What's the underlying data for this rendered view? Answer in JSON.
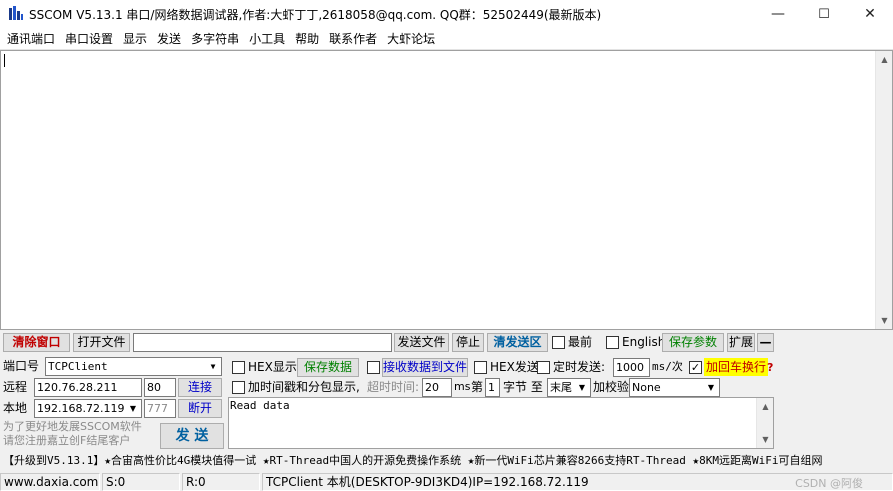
{
  "window": {
    "title": "SSCOM V5.13.1 串口/网络数据调试器,作者:大虾丁丁,2618058@qq.com. QQ群：52502449(最新版本)",
    "minimize": "—",
    "maximize": "☐",
    "close": "✕"
  },
  "menu": [
    "通讯端口",
    "串口设置",
    "显示",
    "发送",
    "多字符串",
    "小工具",
    "帮助",
    "联系作者",
    "大虾论坛"
  ],
  "toolbar": {
    "clear_window": "清除窗口",
    "open_file": "打开文件",
    "send_file": "发送文件",
    "stop": "停止",
    "clear_send": "清发送区",
    "topmost": "最前",
    "english": "English",
    "save_params": "保存参数",
    "expand": "扩展",
    "collapse": "—"
  },
  "connection": {
    "port_label": "端口号",
    "port_value": "TCPClient",
    "remote_label": "远程",
    "remote_ip": "120.76.28.211",
    "remote_port": "80",
    "connect": "连接",
    "local_label": "本地",
    "local_ip": "192.168.72.119",
    "local_port": "777",
    "disconnect": "断开",
    "promo_line1": "为了更好地发展SSCOM软件",
    "promo_line2": "请您注册嘉立创F结尾客户",
    "send": "发 送"
  },
  "options": {
    "hex_display": "HEX显示",
    "save_data": "保存数据",
    "recv_to_file": "接收数据到文件",
    "hex_send": "HEX发送",
    "timed_send": "定时发送:",
    "interval": "1000",
    "interval_unit": "ms/次",
    "add_crlf": "加回车换行",
    "add_crlf_checked": "✓",
    "timestamp": "加时间戳和分包显示,",
    "timeout_label": "超时时间:",
    "timeout_value": "20",
    "timeout_unit": "ms",
    "byte_prefix": "第",
    "byte_index": "1",
    "byte_label": "字节 至",
    "byte_end": "末尾",
    "checksum_label": "加校验",
    "checksum_value": "None",
    "help_mark": "?"
  },
  "send_text": "Read data",
  "promo_bar": "【升级到V5.13.1】★合宙高性价比4G模块值得一试 ★RT-Thread中国人的开源免费操作系统 ★新一代WiFi芯片兼容8266支持RT-Thread ★8KM远距离WiFi可自组网",
  "status": {
    "site": "www.daxia.com",
    "sent": "S:0",
    "received": "R:0",
    "info": "TCPClient 本机(DESKTOP-9DI3KD4)IP=192.168.72.119",
    "watermark": "CSDN @阿俊"
  },
  "colors": {
    "red_button": "#c00000",
    "green_button": "#008000",
    "blue_button": "#0000c8",
    "crlf_highlight": "#ffff00"
  }
}
